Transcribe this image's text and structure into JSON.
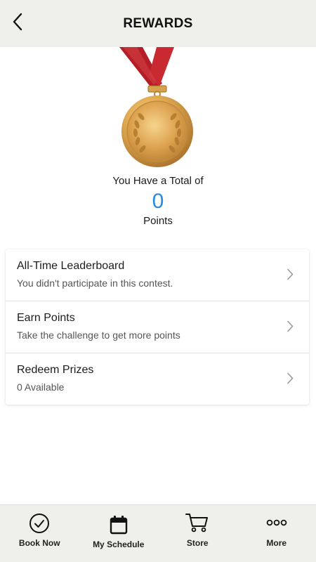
{
  "header": {
    "title": "REWARDS"
  },
  "summary": {
    "total_label": "You Have a Total of",
    "points": "0",
    "points_label": "Points"
  },
  "list": [
    {
      "title": "All-Time Leaderboard",
      "subtitle": "You didn't participate in this contest."
    },
    {
      "title": "Earn Points",
      "subtitle": "Take the challenge to get more points"
    },
    {
      "title": "Redeem Prizes",
      "subtitle": "0 Available"
    }
  ],
  "tabs": [
    {
      "label": "Book Now",
      "icon": "check-circle-icon"
    },
    {
      "label": "My Schedule",
      "icon": "calendar-icon"
    },
    {
      "label": "Store",
      "icon": "cart-icon"
    },
    {
      "label": "More",
      "icon": "more-dots-icon"
    }
  ],
  "colors": {
    "accent": "#2a8ae0",
    "header_bg": "#efefec",
    "ribbon": "#c0232b",
    "gold": "#d9a54a"
  }
}
